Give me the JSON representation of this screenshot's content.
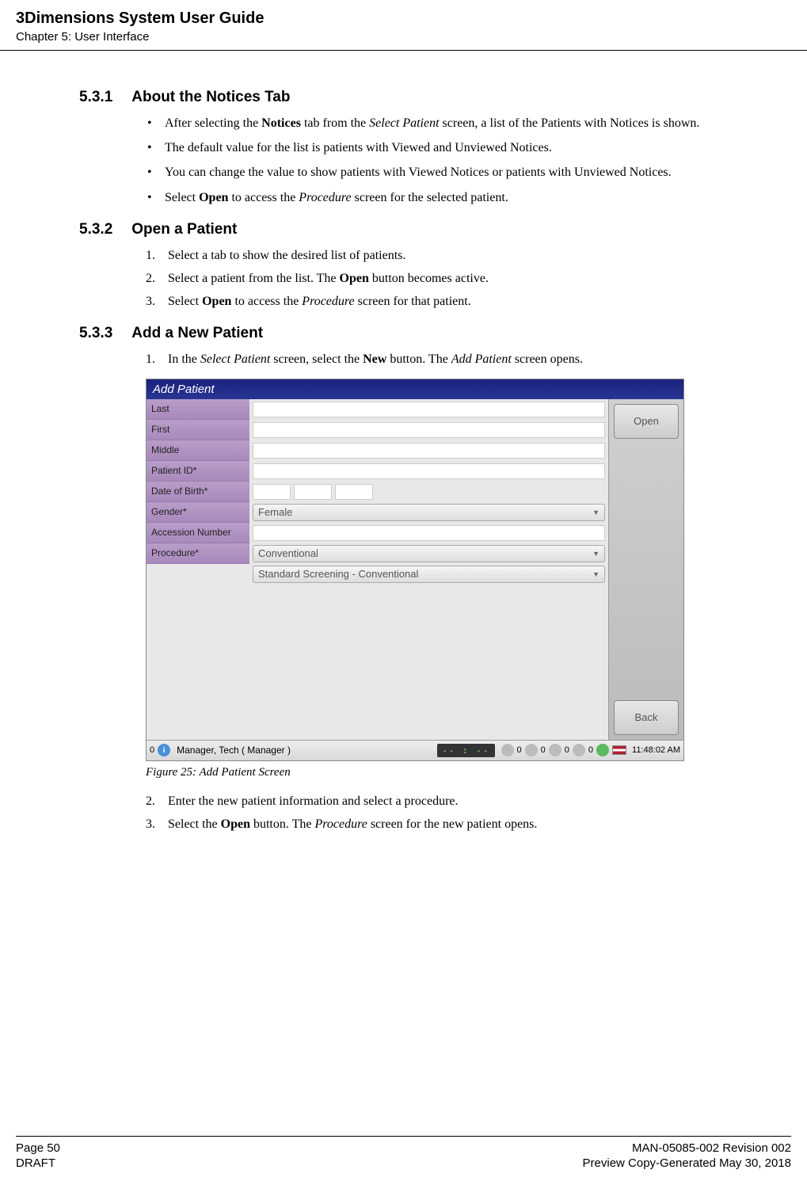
{
  "header": {
    "doc_title": "3Dimensions System User Guide",
    "chapter": "Chapter 5: User Interface"
  },
  "sections": {
    "s531": {
      "num": "5.3.1",
      "title": "About the Notices Tab",
      "bullets": [
        {
          "pre": "After selecting the ",
          "b1": "Notices",
          "mid1": " tab from the ",
          "i1": "Select Patient",
          "post": " screen, a list of the Patients with Notices is shown."
        },
        {
          "text": "The default value for the list is patients with Viewed and Unviewed Notices."
        },
        {
          "text": "You can change the value to show patients with Viewed Notices or patients with Unviewed Notices."
        },
        {
          "pre": "Select ",
          "b1": "Open",
          "mid1": " to access the ",
          "i1": "Procedure",
          "post": " screen for the selected patient."
        }
      ]
    },
    "s532": {
      "num": "5.3.2",
      "title": "Open a Patient",
      "steps": [
        {
          "n": "1.",
          "text": "Select a tab to show the desired list of patients."
        },
        {
          "n": "2.",
          "pre": "Select a patient from the list. The ",
          "b1": "Open",
          "post": " button becomes active."
        },
        {
          "n": "3.",
          "pre": "Select ",
          "b1": "Open",
          "mid1": " to access the ",
          "i1": "Procedure",
          "post": " screen for that patient."
        }
      ]
    },
    "s533": {
      "num": "5.3.3",
      "title": "Add a New Patient",
      "step1": {
        "n": "1.",
        "pre": "In the ",
        "i1": "Select Patient",
        "mid1": " screen, select the ",
        "b1": "New",
        "mid2": " button. The ",
        "i2": "Add Patient",
        "post": " screen opens."
      },
      "step2": {
        "n": "2.",
        "text": "Enter the new patient information and select a procedure."
      },
      "step3": {
        "n": "3.",
        "pre": "Select the ",
        "b1": "Open",
        "mid1": " button. The ",
        "i1": "Procedure",
        "post": " screen for the new patient opens."
      }
    }
  },
  "screenshot": {
    "title": "Add Patient",
    "labels": {
      "last": "Last",
      "first": "First",
      "middle": "Middle",
      "patient_id": "Patient ID*",
      "dob": "Date of Birth*",
      "gender": "Gender*",
      "accession": "Accession Number",
      "procedure": "Procedure*"
    },
    "values": {
      "gender": "Female",
      "procedure": "Conventional",
      "procedure2": "Standard Screening - Conventional"
    },
    "buttons": {
      "open": "Open",
      "back": "Back"
    },
    "status": {
      "num0a": "0",
      "user": "Manager, Tech ( Manager )",
      "lcd": "-- : --",
      "num0b": "0",
      "num0c": "0",
      "num0d": "0",
      "num0e": "0",
      "time": "11:48:02 AM"
    }
  },
  "figure_caption": "Figure 25: Add Patient Screen",
  "footer": {
    "page": "Page 50",
    "draft": "DRAFT",
    "rev": "MAN-05085-002 Revision 002",
    "gen": "Preview Copy-Generated May 30, 2018"
  }
}
